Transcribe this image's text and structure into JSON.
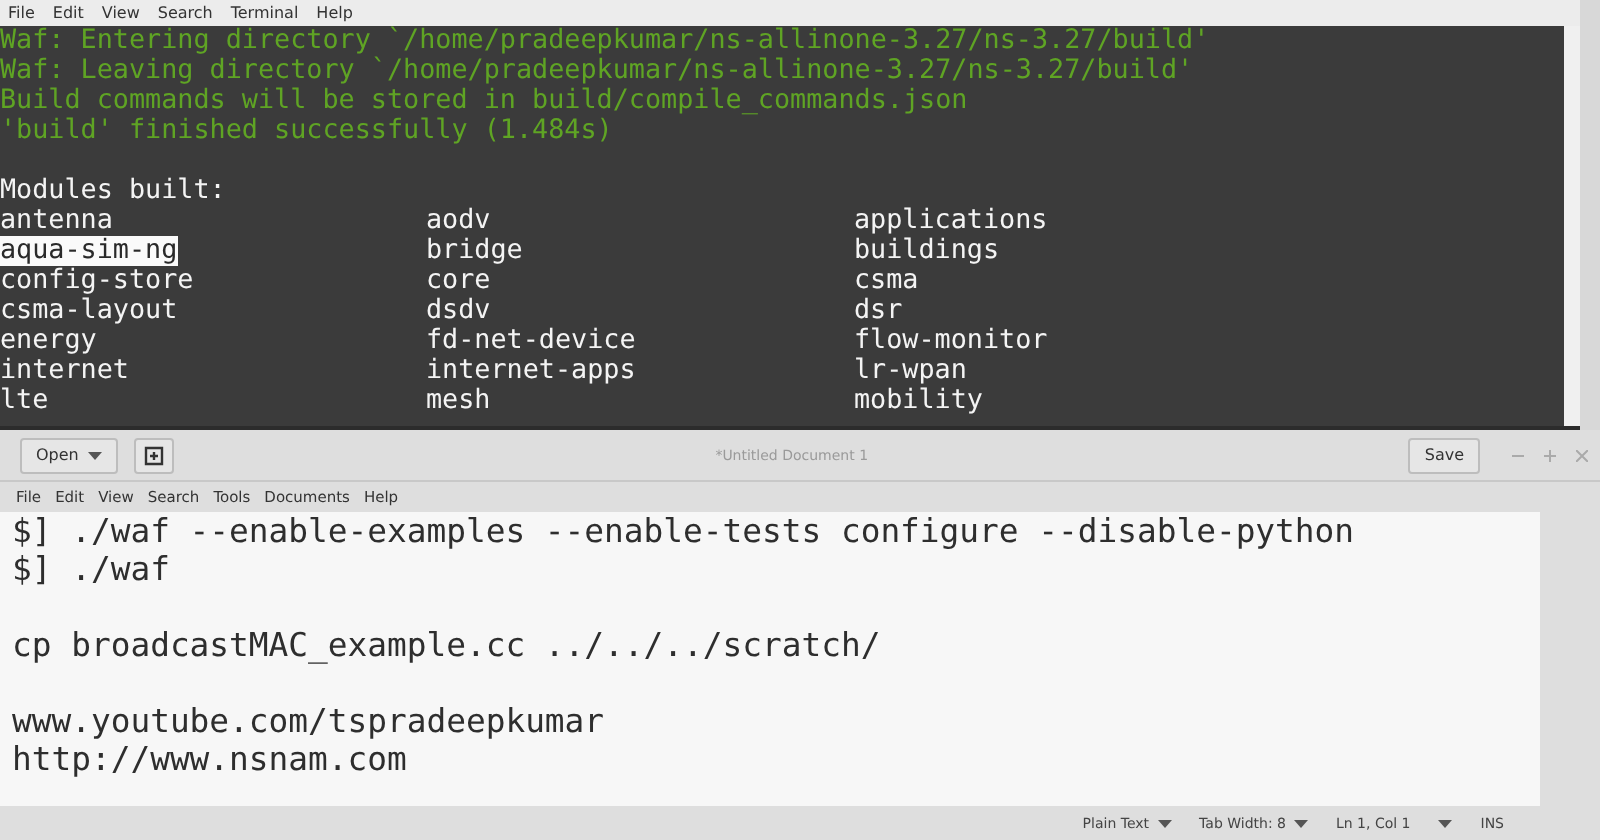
{
  "terminal": {
    "menu": [
      "File",
      "Edit",
      "View",
      "Search",
      "Terminal",
      "Help"
    ],
    "output_lines": [
      "Waf: Entering directory `/home/pradeepkumar/ns-allinone-3.27/ns-3.27/build'",
      "Waf: Leaving directory `/home/pradeepkumar/ns-allinone-3.27/ns-3.27/build'",
      "Build commands will be stored in build/compile_commands.json",
      "'build' finished successfully (1.484s)"
    ],
    "modules_heading": "Modules built:",
    "modules": [
      {
        "name": "antenna",
        "selected": false
      },
      {
        "name": "aodv",
        "selected": false
      },
      {
        "name": "applications",
        "selected": false
      },
      {
        "name": "aqua-sim-ng",
        "selected": true
      },
      {
        "name": "bridge",
        "selected": false
      },
      {
        "name": "buildings",
        "selected": false
      },
      {
        "name": "config-store",
        "selected": false
      },
      {
        "name": "core",
        "selected": false
      },
      {
        "name": "csma",
        "selected": false
      },
      {
        "name": "csma-layout",
        "selected": false
      },
      {
        "name": "dsdv",
        "selected": false
      },
      {
        "name": "dsr",
        "selected": false
      },
      {
        "name": "energy",
        "selected": false
      },
      {
        "name": "fd-net-device",
        "selected": false
      },
      {
        "name": "flow-monitor",
        "selected": false
      },
      {
        "name": "internet",
        "selected": false
      },
      {
        "name": "internet-apps",
        "selected": false
      },
      {
        "name": "lr-wpan",
        "selected": false
      },
      {
        "name": "lte",
        "selected": false
      },
      {
        "name": "mesh",
        "selected": false
      },
      {
        "name": "mobility",
        "selected": false
      }
    ]
  },
  "editor": {
    "open_button": "Open",
    "title": "*Untitled Document 1",
    "save_button": "Save",
    "menu": [
      "File",
      "Edit",
      "View",
      "Search",
      "Tools",
      "Documents",
      "Help"
    ],
    "paragraphs": [
      [
        "$] ./waf --enable-examples --enable-tests configure --disable-python",
        "$] ./waf"
      ],
      [
        "cp broadcastMAC_example.cc ../../../scratch/"
      ],
      [
        "www.youtube.com/tspradeepkumar",
        "http://www.nsnam.com"
      ]
    ],
    "status_bar": {
      "language": "Plain Text",
      "tab_width": "Tab Width: 8",
      "position": "Ln 1, Col 1",
      "mode": "INS"
    }
  }
}
